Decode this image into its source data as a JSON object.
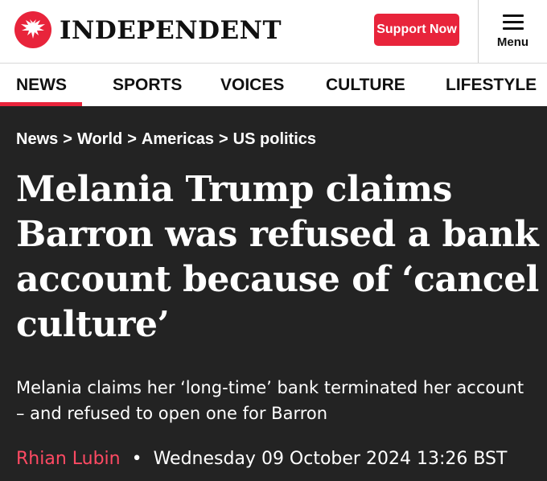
{
  "header": {
    "brand": "INDEPENDENT",
    "logo_icon": "eagle-icon",
    "support_label": "Support Now",
    "menu_label": "Menu",
    "accent_color": "#e8243b"
  },
  "nav": {
    "items": [
      "NEWS",
      "SPORTS",
      "VOICES",
      "CULTURE",
      "LIFESTYLE"
    ],
    "active": "NEWS"
  },
  "breadcrumb": [
    "News",
    "World",
    "Americas",
    "US politics"
  ],
  "breadcrumb_separator": ">",
  "article": {
    "headline": "Melania Trump claims Barron was refused a bank account because of ‘cancel culture’",
    "standfirst": "Melania claims her ‘long-time’ bank terminated her account – and refused to open one for Barron",
    "author": "Rhian Lubin",
    "byline_separator": "•",
    "date": "Wednesday 09 October 2024 13:26 BST"
  },
  "colors": {
    "background": "#232323",
    "author": "#ff4a63"
  }
}
